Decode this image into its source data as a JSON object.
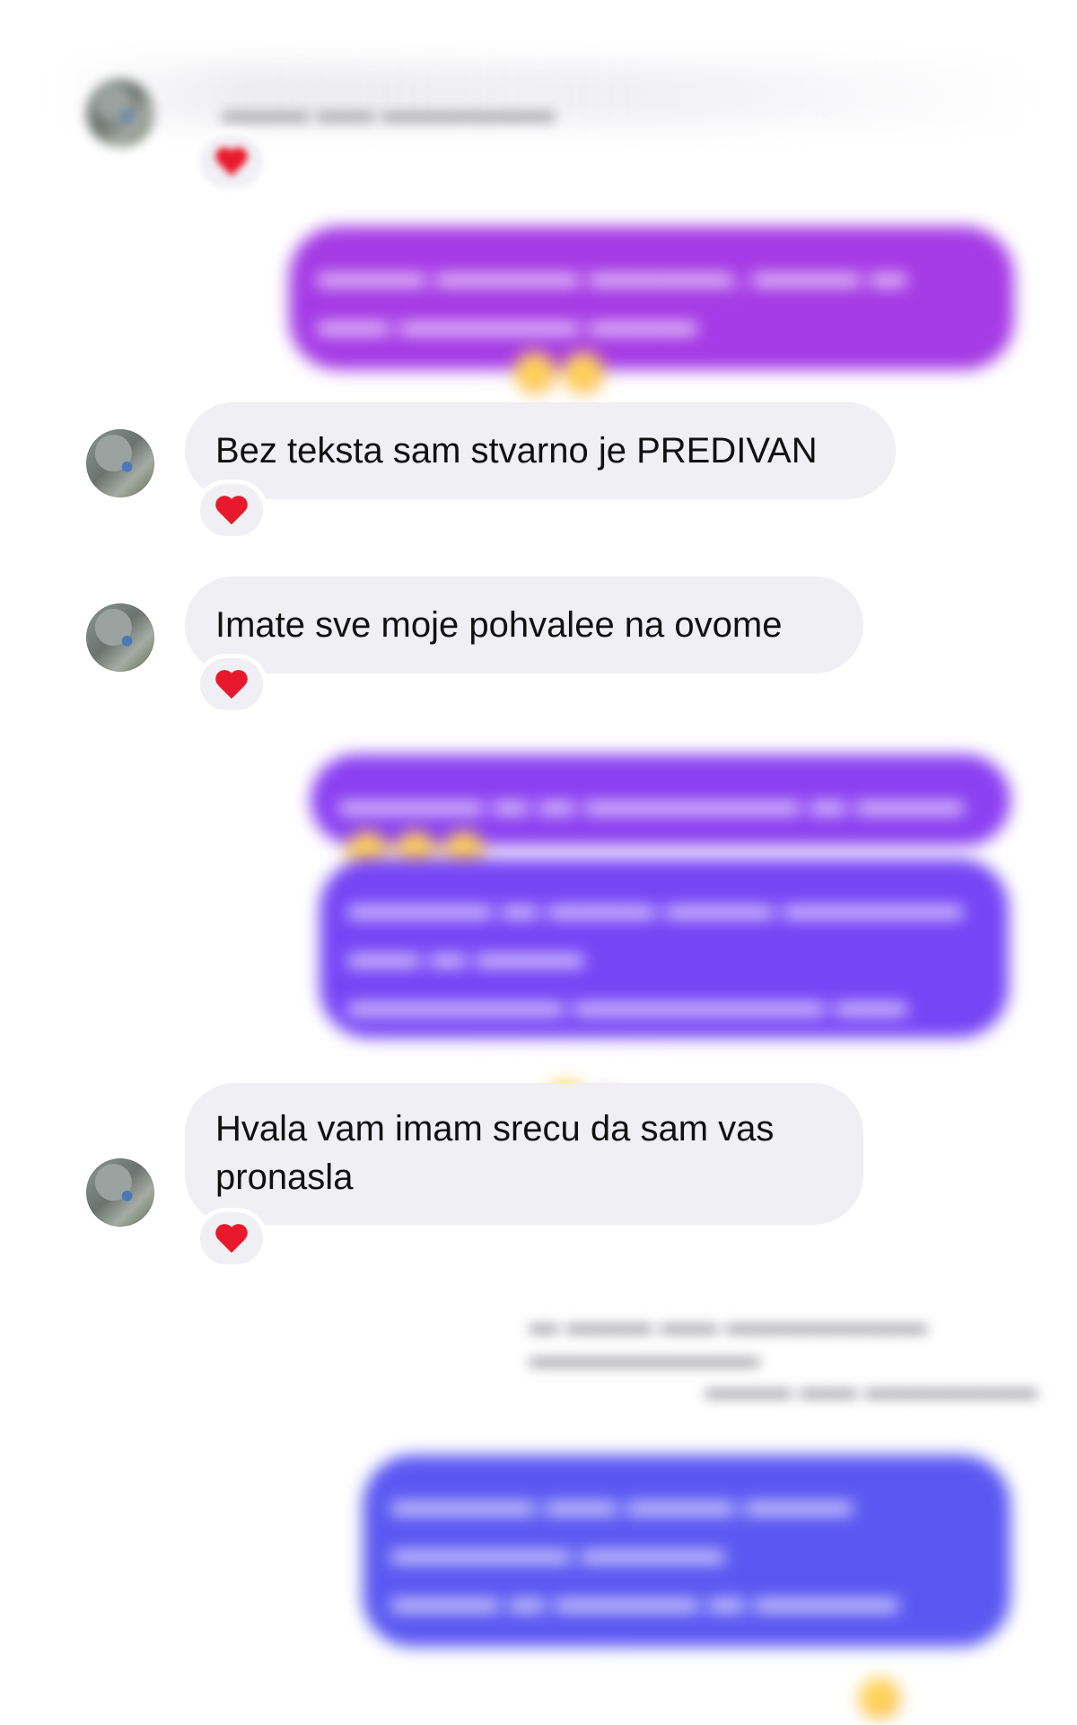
{
  "colors": {
    "incoming_bubble": "#efeff4",
    "outgoing_gradient_top": "#a53be6",
    "outgoing_gradient_mid": "#7a45f5",
    "outgoing_gradient_bottom": "#5b55f2",
    "reaction_heart": "#e8192c"
  },
  "thread": {
    "incoming_1": {
      "text": "Bez teksta sam stvarno je PREDIVAN",
      "reaction": "heart"
    },
    "incoming_2": {
      "text": "Imate sve moje pohvalee na ovome",
      "reaction": "heart"
    },
    "incoming_3": {
      "text": "Hvala vam imam srecu da sam vas pronasla",
      "reaction": "heart"
    }
  }
}
